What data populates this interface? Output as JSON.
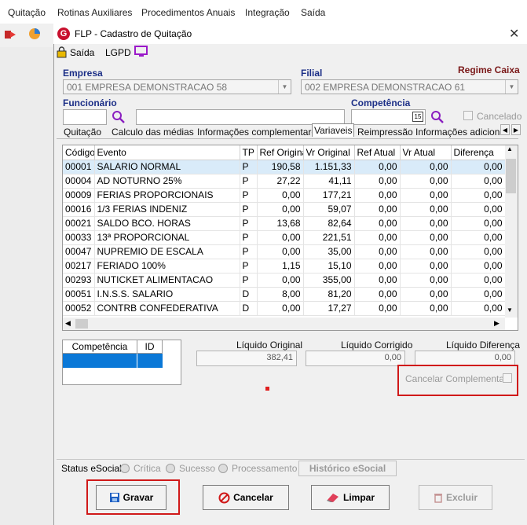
{
  "menu": [
    "Quitação",
    "Rotinas Auxiliares",
    "Procedimentos Anuais",
    "Integração",
    "Saída"
  ],
  "window": {
    "title": "FLP - Cadastro de Quitação",
    "logo": "G"
  },
  "toolbar": {
    "saida": "Saída",
    "lgpd": "LGPD"
  },
  "empresa": {
    "label": "Empresa",
    "value": "001 EMPRESA DEMONSTRACAO 58"
  },
  "filial": {
    "label": "Filial",
    "value": "002 EMPRESA DEMONSTRACAO 61"
  },
  "regime": "Regime Caixa",
  "funcionario": {
    "label": "Funcionário"
  },
  "competencia": {
    "label": "Competência",
    "calendar_day": "15"
  },
  "cancelado": "Cancelado",
  "tabs": [
    "Quitação",
    "Calculo das médias",
    "Informações complementares",
    "Variaveis",
    "Reimpressão",
    "Informações adicionais"
  ],
  "grid": {
    "columns": [
      "Código",
      "Evento",
      "TP",
      "Ref Original",
      "Vr Original",
      "Ref Atual",
      "Vr Atual",
      "Diferença"
    ],
    "rows": [
      [
        "00001",
        "SALARIO NORMAL",
        "P",
        "190,58",
        "1.151,33",
        "0,00",
        "0,00",
        "0,00"
      ],
      [
        "00004",
        "AD NOTURNO 25%",
        "P",
        "27,22",
        "41,11",
        "0,00",
        "0,00",
        "0,00"
      ],
      [
        "00009",
        "FERIAS PROPORCIONAIS",
        "P",
        "0,00",
        "177,21",
        "0,00",
        "0,00",
        "0,00"
      ],
      [
        "00016",
        "1/3 FERIAS INDENIZ",
        "P",
        "0,00",
        "59,07",
        "0,00",
        "0,00",
        "0,00"
      ],
      [
        "00021",
        "SALDO BCO. HORAS",
        "P",
        "13,68",
        "82,64",
        "0,00",
        "0,00",
        "0,00"
      ],
      [
        "00033",
        "13ª PROPORCIONAL",
        "P",
        "0,00",
        "221,51",
        "0,00",
        "0,00",
        "0,00"
      ],
      [
        "00047",
        "NUPREMIO DE ESCALA",
        "P",
        "0,00",
        "35,00",
        "0,00",
        "0,00",
        "0,00"
      ],
      [
        "00217",
        "FERIADO 100%",
        "P",
        "1,15",
        "15,10",
        "0,00",
        "0,00",
        "0,00"
      ],
      [
        "00293",
        "NUTICKET ALIMENTACAO",
        "P",
        "0,00",
        "355,00",
        "0,00",
        "0,00",
        "0,00"
      ],
      [
        "00051",
        "I.N.S.S. SALARIO",
        "D",
        "8,00",
        "81,20",
        "0,00",
        "0,00",
        "0,00"
      ],
      [
        "00052",
        "CONTRB CONFEDERATIVA",
        "D",
        "0,00",
        "17,27",
        "0,00",
        "0,00",
        "0,00"
      ]
    ]
  },
  "comp_grid": {
    "columns": [
      "Competência",
      "ID"
    ]
  },
  "liquido": {
    "original_label": "Líquido Original",
    "original_value": "382,41",
    "corrigido_label": "Líquido Corrigido",
    "corrigido_value": "0,00",
    "diferenca_label": "Líquido Diferença",
    "diferenca_value": "0,00"
  },
  "cancelar_complementar": "Cancelar Complementar",
  "status": {
    "label": "Status eSocial:",
    "critica": "Crítica",
    "sucesso": "Sucesso",
    "processamento": "Processamento",
    "historico": "Histórico eSocial"
  },
  "buttons": {
    "gravar": "Gravar",
    "cancelar": "Cancelar",
    "limpar": "Limpar",
    "excluir": "Excluir"
  },
  "colors": {
    "label_blue": "#1c2f87",
    "label_red": "#7a1818",
    "highlight_red": "#d01919",
    "selection_blue": "#0a78d7"
  }
}
